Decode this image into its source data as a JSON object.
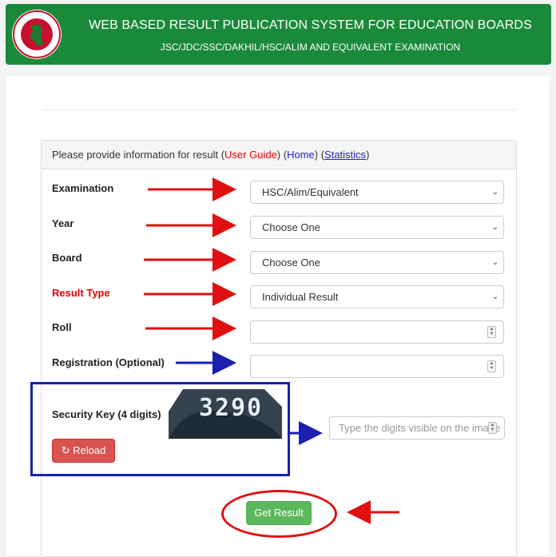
{
  "header": {
    "title": "WEB BASED RESULT PUBLICATION SYSTEM FOR EDUCATION BOARDS",
    "subtitle": "JSC/JDC/SSC/DAKHIL/HSC/ALIM AND EQUIVALENT EXAMINATION",
    "logo_icon": "bangladesh-govt-seal-icon",
    "bg_color": "#1a8a3a"
  },
  "panel": {
    "intro": "Please provide information for result (",
    "user_guide": "User Guide",
    "mid1": ") (",
    "home": "Home",
    "mid2": ") (",
    "statistics": "Statistics",
    "end": ")"
  },
  "form": {
    "examination_label": "Examination",
    "examination_value": "HSC/Alim/Equivalent",
    "year_label": "Year",
    "year_value": "Choose One",
    "board_label": "Board",
    "board_value": "Choose One",
    "result_type_label": "Result Type",
    "result_type_value": "Individual Result",
    "roll_label": "Roll",
    "roll_value": "",
    "registration_label": "Registration (Optional)",
    "registration_value": "",
    "security_label": "Security Key (4 digits)",
    "captcha_text": "3290",
    "security_placeholder": "Type the digits visible on the image",
    "reload_label": "Reload",
    "reload_icon": "refresh-icon",
    "submit_label": "Get Result"
  },
  "colors": {
    "accent_red": "#e00000",
    "annotation_blue": "#1a20b0",
    "submit_green": "#5cb85c",
    "reload_red": "#d9534f"
  }
}
